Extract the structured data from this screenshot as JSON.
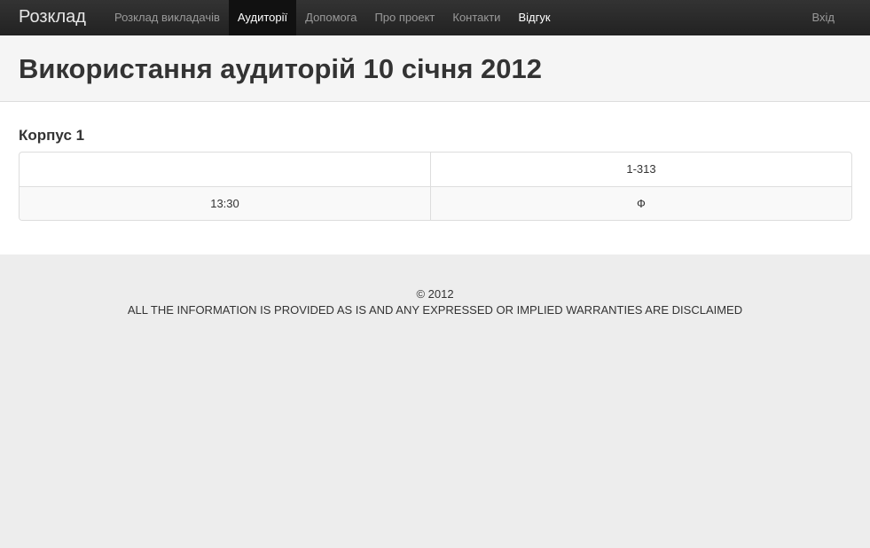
{
  "navbar": {
    "brand": "Розклад",
    "items": [
      {
        "label": "Розклад викладачів"
      },
      {
        "label": "Аудиторії"
      },
      {
        "label": "Допомога"
      },
      {
        "label": "Про проект"
      },
      {
        "label": "Контакти"
      },
      {
        "label": "Відгук"
      }
    ],
    "active_item": "Аудиторії",
    "login": "Вхід"
  },
  "page": {
    "title": "Використання аудиторій 10 січня 2012"
  },
  "main": {
    "section_title": "Корпус 1",
    "table": {
      "header": [
        "",
        "1-313"
      ],
      "rows": [
        [
          "13:30",
          "Ф"
        ]
      ]
    }
  },
  "footer": {
    "copyright": "© 2012",
    "disclaimer": "ALL THE INFORMATION IS PROVIDED AS IS AND ANY EXPRESSED OR IMPLIED WARRANTIES ARE DISCLAIMED"
  },
  "colors": {
    "navbar_bg": "#222222",
    "active_nav_bg": "#111111",
    "page_header_bg": "#f5f5f5",
    "footer_bg": "#ededed"
  }
}
